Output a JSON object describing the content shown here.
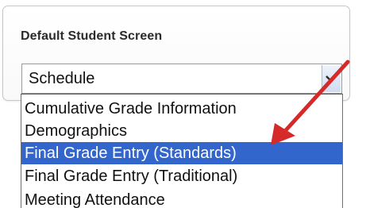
{
  "panel": {
    "label": "Default Student Screen"
  },
  "select": {
    "value": "Schedule"
  },
  "dropdown": {
    "options": [
      "Cumulative Grade Information",
      "Demographics",
      "Final Grade Entry (Standards)",
      "Final Grade Entry (Traditional)",
      "Meeting Attendance"
    ],
    "selected_index": 2
  },
  "colors": {
    "highlight": "#3366cc",
    "annotation_arrow": "#d42a2a"
  },
  "icons": {
    "dropdown_toggle": "chevron-down-icon",
    "annotation": "red-arrow"
  }
}
